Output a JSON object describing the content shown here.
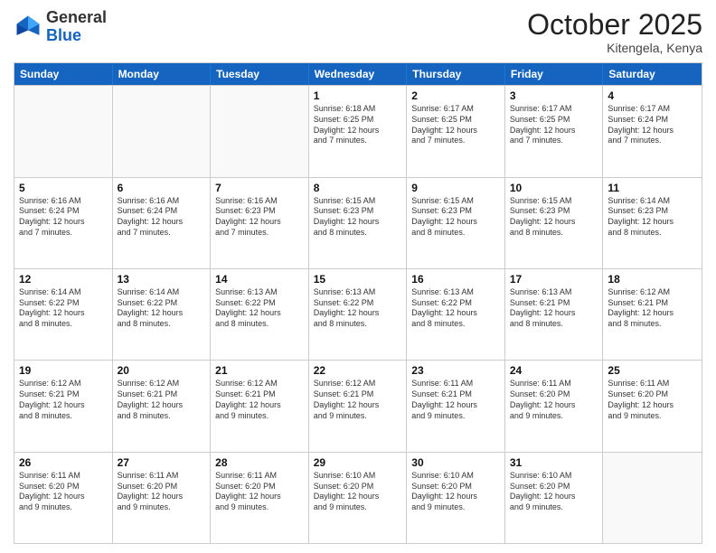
{
  "header": {
    "logo_general": "General",
    "logo_blue": "Blue",
    "month": "October 2025",
    "location": "Kitengela, Kenya"
  },
  "days_of_week": [
    "Sunday",
    "Monday",
    "Tuesday",
    "Wednesday",
    "Thursday",
    "Friday",
    "Saturday"
  ],
  "weeks": [
    [
      {
        "day": "",
        "info": ""
      },
      {
        "day": "",
        "info": ""
      },
      {
        "day": "",
        "info": ""
      },
      {
        "day": "1",
        "info": "Sunrise: 6:18 AM\nSunset: 6:25 PM\nDaylight: 12 hours\nand 7 minutes."
      },
      {
        "day": "2",
        "info": "Sunrise: 6:17 AM\nSunset: 6:25 PM\nDaylight: 12 hours\nand 7 minutes."
      },
      {
        "day": "3",
        "info": "Sunrise: 6:17 AM\nSunset: 6:25 PM\nDaylight: 12 hours\nand 7 minutes."
      },
      {
        "day": "4",
        "info": "Sunrise: 6:17 AM\nSunset: 6:24 PM\nDaylight: 12 hours\nand 7 minutes."
      }
    ],
    [
      {
        "day": "5",
        "info": "Sunrise: 6:16 AM\nSunset: 6:24 PM\nDaylight: 12 hours\nand 7 minutes."
      },
      {
        "day": "6",
        "info": "Sunrise: 6:16 AM\nSunset: 6:24 PM\nDaylight: 12 hours\nand 7 minutes."
      },
      {
        "day": "7",
        "info": "Sunrise: 6:16 AM\nSunset: 6:23 PM\nDaylight: 12 hours\nand 7 minutes."
      },
      {
        "day": "8",
        "info": "Sunrise: 6:15 AM\nSunset: 6:23 PM\nDaylight: 12 hours\nand 8 minutes."
      },
      {
        "day": "9",
        "info": "Sunrise: 6:15 AM\nSunset: 6:23 PM\nDaylight: 12 hours\nand 8 minutes."
      },
      {
        "day": "10",
        "info": "Sunrise: 6:15 AM\nSunset: 6:23 PM\nDaylight: 12 hours\nand 8 minutes."
      },
      {
        "day": "11",
        "info": "Sunrise: 6:14 AM\nSunset: 6:23 PM\nDaylight: 12 hours\nand 8 minutes."
      }
    ],
    [
      {
        "day": "12",
        "info": "Sunrise: 6:14 AM\nSunset: 6:22 PM\nDaylight: 12 hours\nand 8 minutes."
      },
      {
        "day": "13",
        "info": "Sunrise: 6:14 AM\nSunset: 6:22 PM\nDaylight: 12 hours\nand 8 minutes."
      },
      {
        "day": "14",
        "info": "Sunrise: 6:13 AM\nSunset: 6:22 PM\nDaylight: 12 hours\nand 8 minutes."
      },
      {
        "day": "15",
        "info": "Sunrise: 6:13 AM\nSunset: 6:22 PM\nDaylight: 12 hours\nand 8 minutes."
      },
      {
        "day": "16",
        "info": "Sunrise: 6:13 AM\nSunset: 6:22 PM\nDaylight: 12 hours\nand 8 minutes."
      },
      {
        "day": "17",
        "info": "Sunrise: 6:13 AM\nSunset: 6:21 PM\nDaylight: 12 hours\nand 8 minutes."
      },
      {
        "day": "18",
        "info": "Sunrise: 6:12 AM\nSunset: 6:21 PM\nDaylight: 12 hours\nand 8 minutes."
      }
    ],
    [
      {
        "day": "19",
        "info": "Sunrise: 6:12 AM\nSunset: 6:21 PM\nDaylight: 12 hours\nand 8 minutes."
      },
      {
        "day": "20",
        "info": "Sunrise: 6:12 AM\nSunset: 6:21 PM\nDaylight: 12 hours\nand 8 minutes."
      },
      {
        "day": "21",
        "info": "Sunrise: 6:12 AM\nSunset: 6:21 PM\nDaylight: 12 hours\nand 9 minutes."
      },
      {
        "day": "22",
        "info": "Sunrise: 6:12 AM\nSunset: 6:21 PM\nDaylight: 12 hours\nand 9 minutes."
      },
      {
        "day": "23",
        "info": "Sunrise: 6:11 AM\nSunset: 6:21 PM\nDaylight: 12 hours\nand 9 minutes."
      },
      {
        "day": "24",
        "info": "Sunrise: 6:11 AM\nSunset: 6:20 PM\nDaylight: 12 hours\nand 9 minutes."
      },
      {
        "day": "25",
        "info": "Sunrise: 6:11 AM\nSunset: 6:20 PM\nDaylight: 12 hours\nand 9 minutes."
      }
    ],
    [
      {
        "day": "26",
        "info": "Sunrise: 6:11 AM\nSunset: 6:20 PM\nDaylight: 12 hours\nand 9 minutes."
      },
      {
        "day": "27",
        "info": "Sunrise: 6:11 AM\nSunset: 6:20 PM\nDaylight: 12 hours\nand 9 minutes."
      },
      {
        "day": "28",
        "info": "Sunrise: 6:11 AM\nSunset: 6:20 PM\nDaylight: 12 hours\nand 9 minutes."
      },
      {
        "day": "29",
        "info": "Sunrise: 6:10 AM\nSunset: 6:20 PM\nDaylight: 12 hours\nand 9 minutes."
      },
      {
        "day": "30",
        "info": "Sunrise: 6:10 AM\nSunset: 6:20 PM\nDaylight: 12 hours\nand 9 minutes."
      },
      {
        "day": "31",
        "info": "Sunrise: 6:10 AM\nSunset: 6:20 PM\nDaylight: 12 hours\nand 9 minutes."
      },
      {
        "day": "",
        "info": ""
      }
    ]
  ]
}
